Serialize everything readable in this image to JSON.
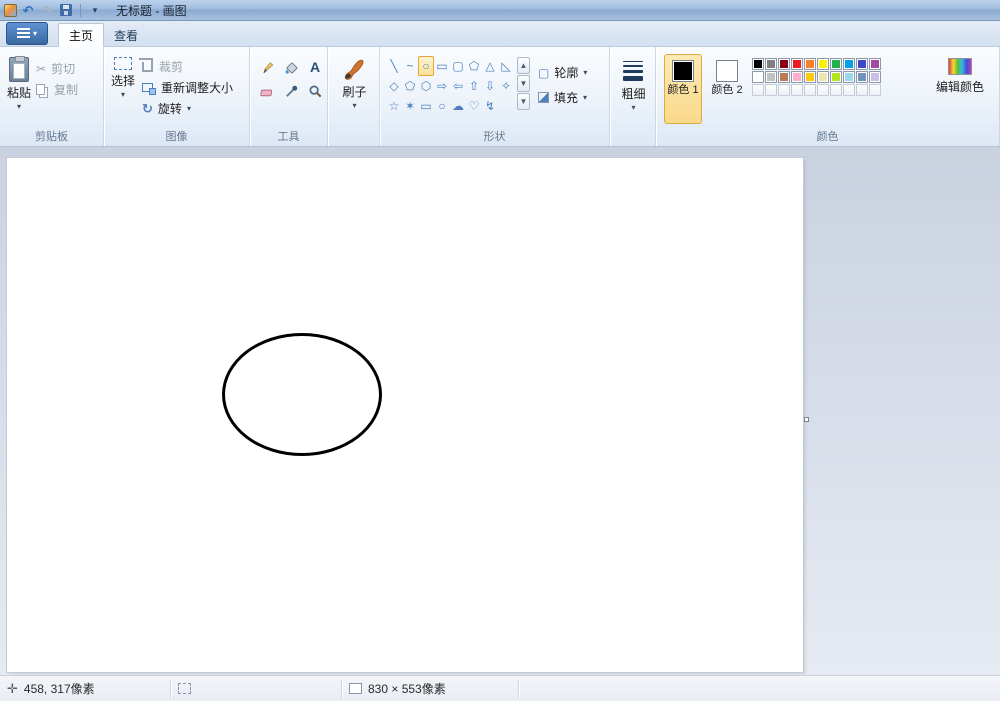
{
  "window": {
    "title": "无标题 - 画图"
  },
  "tabs": [
    {
      "label": "主页",
      "active": true
    },
    {
      "label": "查看",
      "active": false
    }
  ],
  "icons": {
    "undo": "↶",
    "redo": "↷",
    "dropdown": "▾",
    "cut": "✂",
    "rotate": "↻",
    "text_tool": "A",
    "move": "✛",
    "scroll_up": "▲",
    "scroll_down": "▼",
    "scroll_more": "▼"
  },
  "ribbon": {
    "clipboard": {
      "group_label": "剪贴板",
      "paste": "粘贴",
      "cut": "剪切",
      "copy": "复制"
    },
    "image": {
      "group_label": "图像",
      "select": "选择",
      "crop": "裁剪",
      "resize": "重新调整大小",
      "rotate": "旋转"
    },
    "tools": {
      "group_label": "工具"
    },
    "brushes": {
      "label": "刷子"
    },
    "shapes": {
      "group_label": "形状",
      "outline": "轮廓",
      "fill": "填充",
      "items": [
        {
          "name": "line",
          "glyph": "╲"
        },
        {
          "name": "curve",
          "glyph": "~"
        },
        {
          "name": "oval",
          "glyph": "○",
          "selected": true
        },
        {
          "name": "rectangle",
          "glyph": "▭"
        },
        {
          "name": "rounded-rectangle",
          "glyph": "▢"
        },
        {
          "name": "polygon",
          "glyph": "⬠"
        },
        {
          "name": "triangle",
          "glyph": "△"
        },
        {
          "name": "right-triangle",
          "glyph": "◺"
        },
        {
          "name": "diamond",
          "glyph": "◇"
        },
        {
          "name": "pentagon",
          "glyph": "⬠"
        },
        {
          "name": "hexagon",
          "glyph": "⬡"
        },
        {
          "name": "arrow-right",
          "glyph": "⇨"
        },
        {
          "name": "arrow-left",
          "glyph": "⇦"
        },
        {
          "name": "arrow-up",
          "glyph": "⇧"
        },
        {
          "name": "arrow-down",
          "glyph": "⇩"
        },
        {
          "name": "star-4",
          "glyph": "✧"
        },
        {
          "name": "star-5",
          "glyph": "☆"
        },
        {
          "name": "star-6",
          "glyph": "✶"
        },
        {
          "name": "callout-rounded",
          "glyph": "▭"
        },
        {
          "name": "callout-oval",
          "glyph": "○"
        },
        {
          "name": "callout-cloud",
          "glyph": "☁"
        },
        {
          "name": "heart",
          "glyph": "♡"
        },
        {
          "name": "lightning",
          "glyph": "↯"
        }
      ]
    },
    "size": {
      "label": "粗细"
    },
    "colors": {
      "group_label": "颜色",
      "color1_label": "颜色 1",
      "color2_label": "颜色 2",
      "edit_label": "编辑颜色",
      "color1": "#000000",
      "color2": "#ffffff",
      "palette_row1": [
        "#000000",
        "#7f7f7f",
        "#880015",
        "#ed1c24",
        "#ff7f27",
        "#fff200",
        "#22b14c",
        "#00a2e8",
        "#3f48cc",
        "#a349a4"
      ],
      "palette_row2": [
        "#ffffff",
        "#c3c3c3",
        "#b97a57",
        "#ffaec9",
        "#ffc90e",
        "#efe4b0",
        "#b5e61d",
        "#99d9ea",
        "#7092be",
        "#c8bfe7"
      ],
      "custom_empty_slots": 10
    }
  },
  "canvas": {
    "ellipse_stroke": "#000000"
  },
  "status": {
    "cursor_position": "458, 317像素",
    "canvas_size": "830 × 553像素"
  }
}
